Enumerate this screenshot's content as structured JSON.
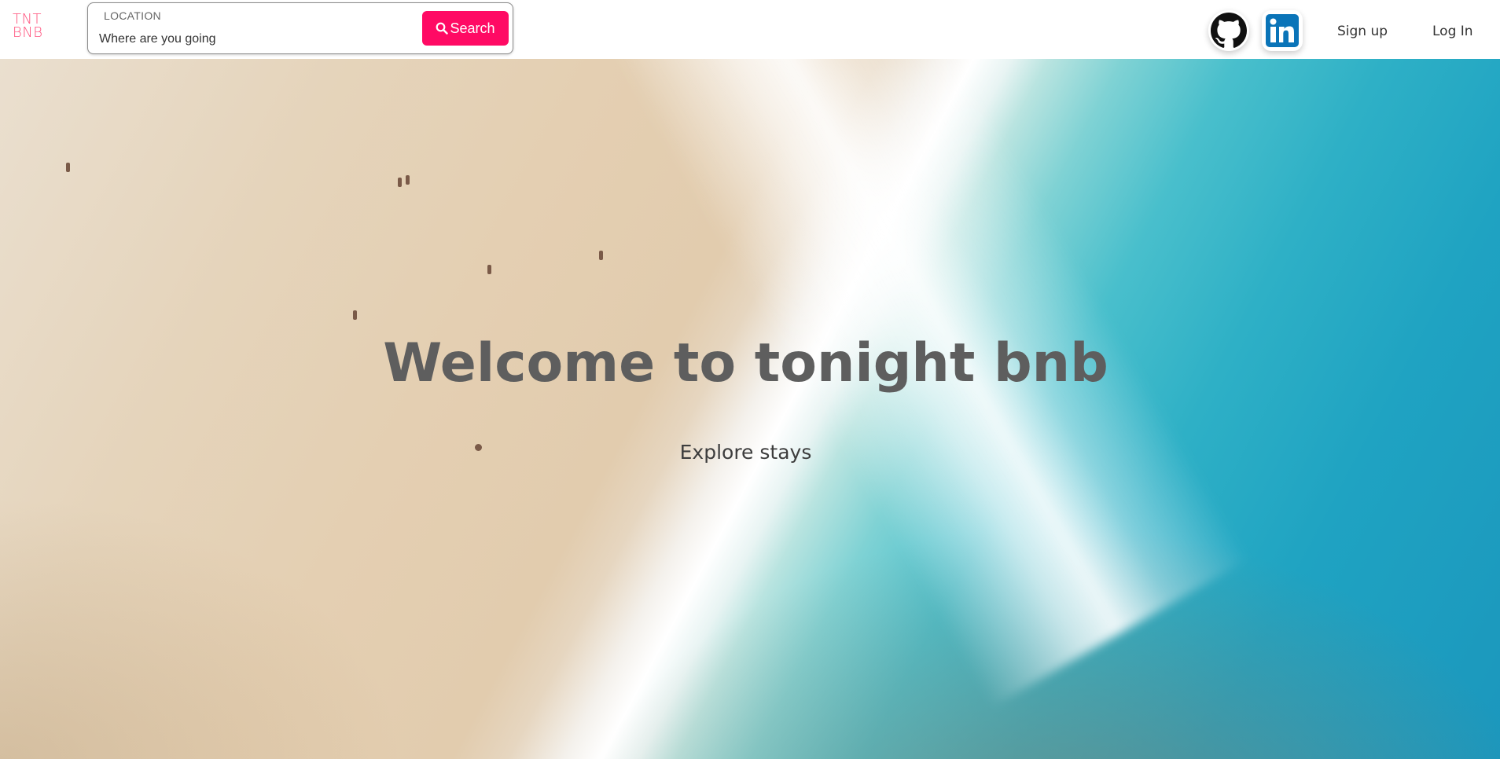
{
  "logo": {
    "line1": "TNT",
    "line2": "BNB"
  },
  "search": {
    "label": "LOCATION",
    "placeholder": "Where are you going",
    "button_label": "Search"
  },
  "nav": {
    "github_icon": "github-icon",
    "linkedin_icon": "linkedin-icon",
    "signup": "Sign up",
    "login": "Log In"
  },
  "hero": {
    "title": "Welcome to tonight bnb",
    "subtitle": "Explore stays"
  },
  "colors": {
    "brand": "#ff0a64",
    "logo": "#ff4f7b"
  }
}
